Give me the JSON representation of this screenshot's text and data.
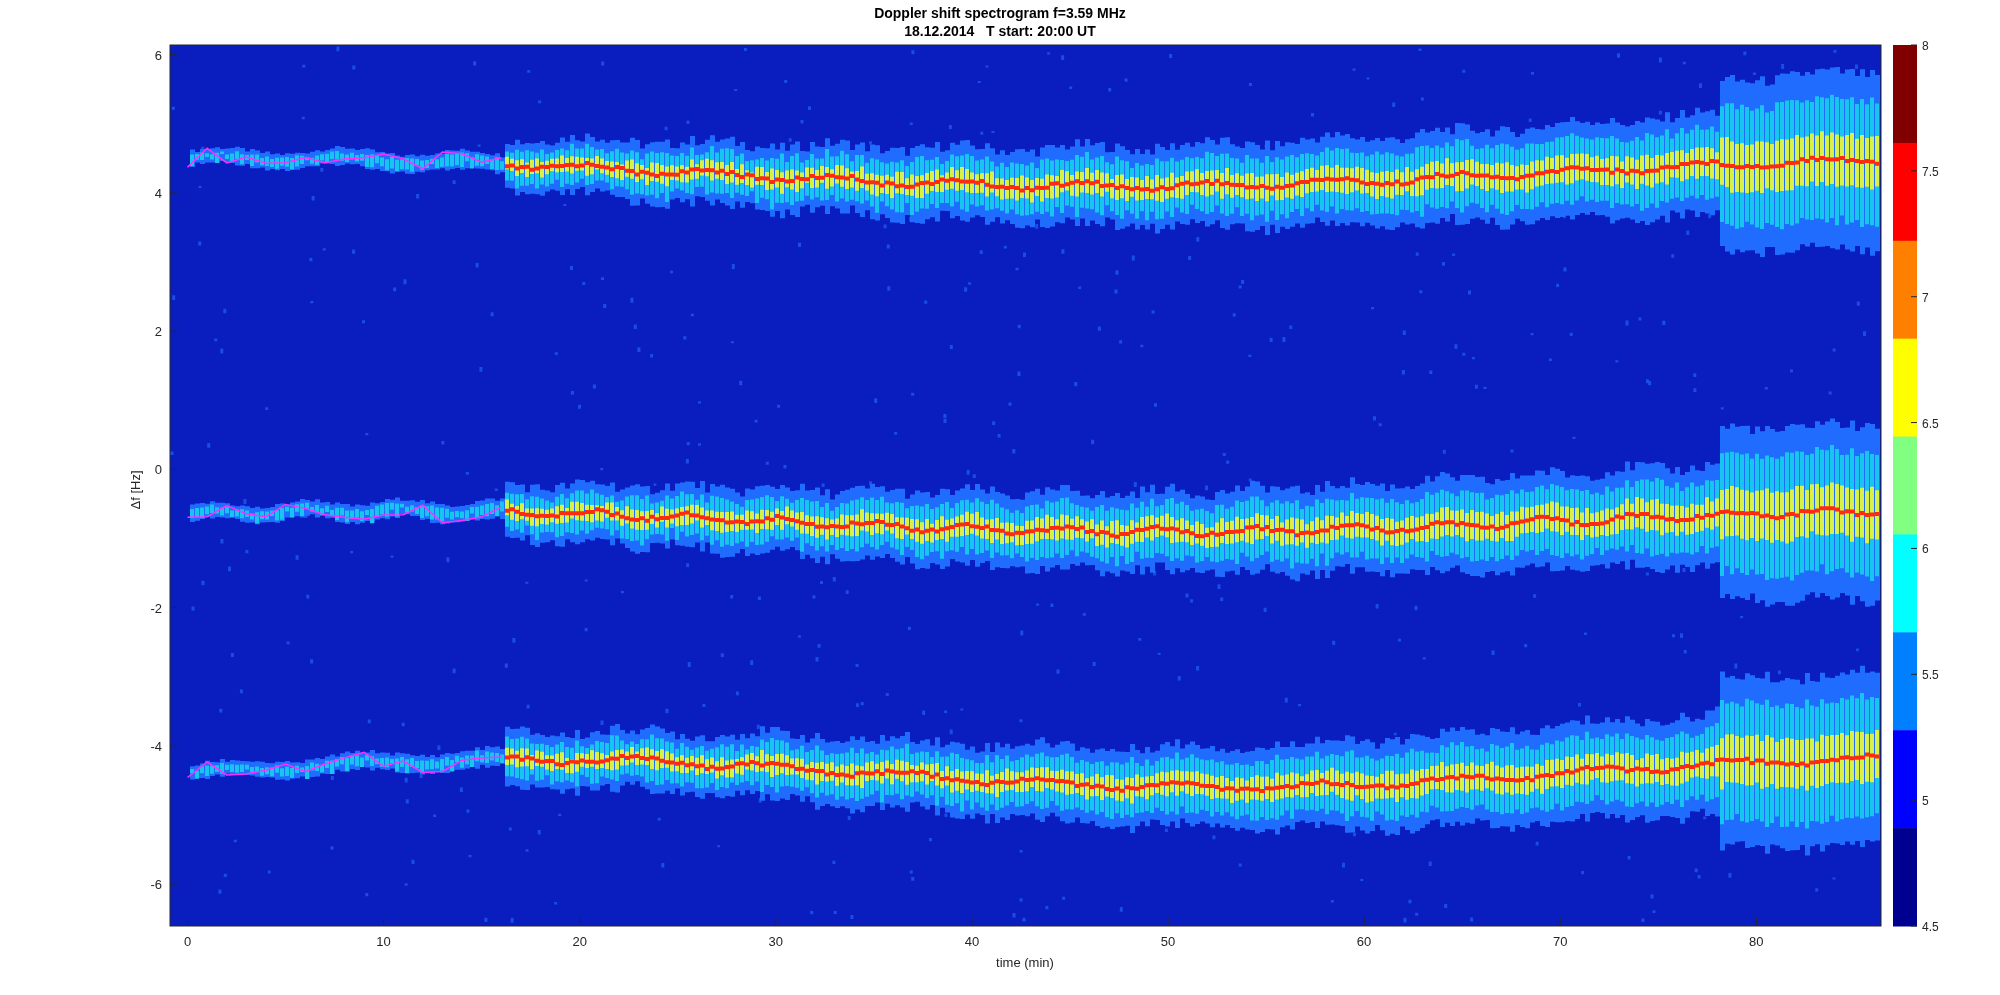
{
  "title": [
    "Doppler shift spectrogram f=3.59 MHz",
    "18.12.2014   T start: 20:00 UT"
  ],
  "ylabel": "Δf [Hz]",
  "xlabel": "time (min)",
  "yticks": [
    "6",
    "4",
    "2",
    "0",
    "-2",
    "-4",
    "-6"
  ],
  "xticks": [
    "0",
    "10",
    "20",
    "30",
    "40",
    "50",
    "60",
    "70",
    "80"
  ],
  "colorbar_ticks": [
    "8",
    "7.5",
    "7",
    "6.5",
    "6",
    "5.5",
    "5",
    "4.5"
  ]
}
